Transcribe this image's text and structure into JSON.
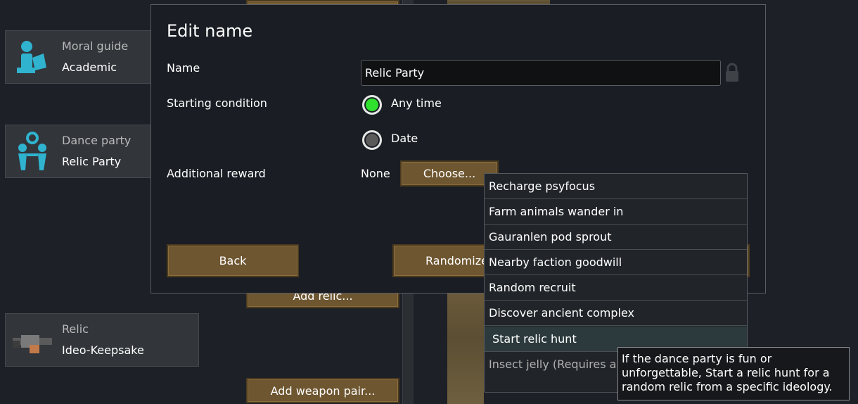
{
  "background": {
    "cards": [
      {
        "title": "Moral guide",
        "subtitle": "Academic",
        "icon": "moral-guide-icon"
      },
      {
        "title": "Dance party",
        "subtitle": "Relic Party",
        "icon": "dance-party-icon"
      },
      {
        "title": "Relic",
        "subtitle": "Ideo-Keepsake",
        "icon": "gun-relic-icon"
      }
    ],
    "add_relic_label": "Add relic...",
    "add_weapon_label": "Add weapon pair..."
  },
  "dialog": {
    "title": "Edit name",
    "name_label": "Name",
    "name_value": "Relic Party",
    "starting_condition_label": "Starting condition",
    "option_any_time": "Any time",
    "option_date": "Date",
    "additional_reward_label": "Additional reward",
    "reward_value": "None",
    "choose_label": "Choose...",
    "back_label": "Back",
    "randomize_label": "Randomize"
  },
  "menu": {
    "items": [
      "Recharge psyfocus",
      "Farm animals wander in",
      "Gauranlen pod sprout",
      "Nearby faction goodwill",
      "Random recruit",
      "Discover ancient complex",
      "Start relic hunt",
      "Insect jelly (Requires a Tunneler)"
    ]
  },
  "tooltip": {
    "text": "If the dance party is fun or unforgettable, Start a relic hunt for a random relic from a specific ideology."
  },
  "colors": {
    "accent_green": "#2fe02f",
    "button_brown": "#6e5630",
    "icon_cyan": "#2fb3cf"
  }
}
